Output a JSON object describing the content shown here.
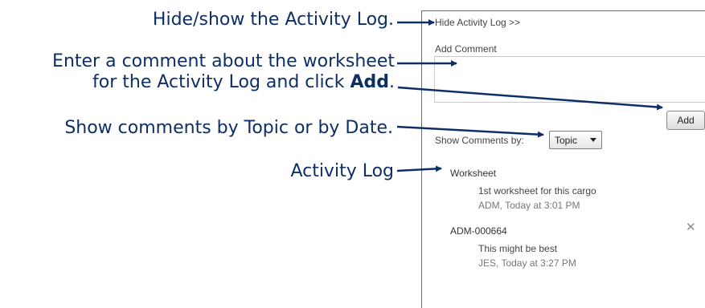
{
  "callouts": {
    "hide_show": "Hide/show the Activity Log.",
    "enter_comment_line1": "Enter a comment about the worksheet",
    "enter_comment_line2_pre": "for the Activity Log and click ",
    "enter_comment_line2_bold": "Add",
    "enter_comment_line2_post": ".",
    "show_comments": "Show comments by Topic or by Date.",
    "activity_log": "Activity Log"
  },
  "panel": {
    "hide_link": "Hide Activity Log >>",
    "add_comment_label": "Add Comment",
    "comment_value": "",
    "add_button": "Add",
    "show_comments_label": "Show Comments by:",
    "show_comments_selected": "Topic",
    "entries": [
      {
        "topic": "Worksheet",
        "text": "1st worksheet for this cargo",
        "meta": "ADM, Today at 3:01 PM"
      },
      {
        "topic": "ADM-000664",
        "text": "This might be best",
        "meta": "JES, Today at 3:27 PM"
      }
    ]
  },
  "icons": {
    "delete": "close-x-icon",
    "dropdown": "caret-down-icon"
  },
  "colors": {
    "callout_text": "#0d2f66",
    "arrow": "#0d2f66"
  }
}
